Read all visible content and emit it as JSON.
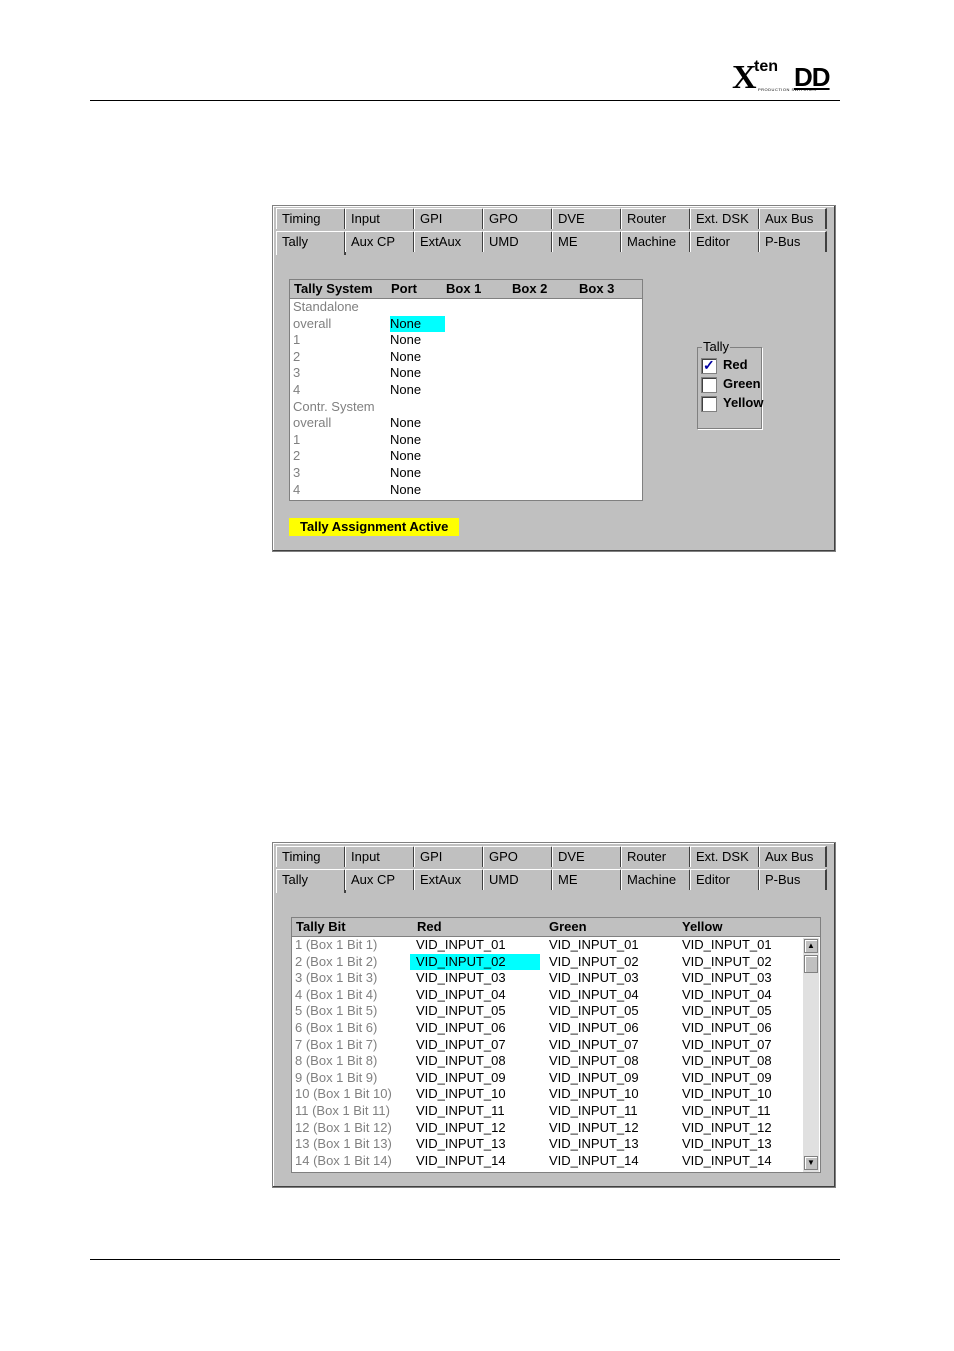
{
  "header": {
    "logo_x": "X",
    "logo_ten": "ten",
    "logo_dd": "DD",
    "logo_tagline": "PRODUCTION SWITCHER"
  },
  "tabs_row1": [
    "Timing",
    "Input",
    "GPI",
    "GPO",
    "DVE",
    "Router",
    "Ext. DSK",
    "Aux Bus"
  ],
  "tabs_row2": [
    "Tally",
    "Aux CP",
    "ExtAux",
    "UMD",
    "ME",
    "Machine",
    "Editor",
    "P-Bus"
  ],
  "panel1": {
    "columns": [
      "Tally System",
      "Port",
      "Box 1",
      "Box 2",
      "Box 3"
    ],
    "rows": [
      {
        "label": "Standalone",
        "port": ""
      },
      {
        "label": "overall",
        "port": "None",
        "highlight": true
      },
      {
        "label": "1",
        "port": "None"
      },
      {
        "label": "2",
        "port": "None"
      },
      {
        "label": "3",
        "port": "None"
      },
      {
        "label": "4",
        "port": "None"
      },
      {
        "label": "Contr. System",
        "port": ""
      },
      {
        "label": "overall",
        "port": "None"
      },
      {
        "label": "1",
        "port": "None"
      },
      {
        "label": "2",
        "port": "None"
      },
      {
        "label": "3",
        "port": "None"
      },
      {
        "label": "4",
        "port": "None"
      }
    ],
    "tally_group": {
      "title": "Tally",
      "options": [
        {
          "label": "Red",
          "checked": true
        },
        {
          "label": "Green",
          "checked": false
        },
        {
          "label": "Yellow",
          "checked": false
        }
      ]
    },
    "status": "Tally Assignment Active",
    "check_mark": "✓"
  },
  "panel2": {
    "columns": [
      "Tally Bit",
      "Red",
      "Green",
      "Yellow"
    ],
    "rows": [
      {
        "bit": "1 (Box 1 Bit 1)",
        "red": "VID_INPUT_01",
        "green": "VID_INPUT_01",
        "yellow": "VID_INPUT_01"
      },
      {
        "bit": "2 (Box 1 Bit 2)",
        "red": "VID_INPUT_02",
        "green": "VID_INPUT_02",
        "yellow": "VID_INPUT_02",
        "highlight": true
      },
      {
        "bit": "3 (Box 1 Bit 3)",
        "red": "VID_INPUT_03",
        "green": "VID_INPUT_03",
        "yellow": "VID_INPUT_03"
      },
      {
        "bit": "4 (Box 1 Bit 4)",
        "red": "VID_INPUT_04",
        "green": "VID_INPUT_04",
        "yellow": "VID_INPUT_04"
      },
      {
        "bit": "5 (Box 1 Bit 5)",
        "red": "VID_INPUT_05",
        "green": "VID_INPUT_05",
        "yellow": "VID_INPUT_05"
      },
      {
        "bit": "6 (Box 1 Bit 6)",
        "red": "VID_INPUT_06",
        "green": "VID_INPUT_06",
        "yellow": "VID_INPUT_06"
      },
      {
        "bit": "7 (Box 1 Bit 7)",
        "red": "VID_INPUT_07",
        "green": "VID_INPUT_07",
        "yellow": "VID_INPUT_07"
      },
      {
        "bit": "8 (Box 1 Bit 8)",
        "red": "VID_INPUT_08",
        "green": "VID_INPUT_08",
        "yellow": "VID_INPUT_08"
      },
      {
        "bit": "9 (Box 1 Bit 9)",
        "red": "VID_INPUT_09",
        "green": "VID_INPUT_09",
        "yellow": "VID_INPUT_09"
      },
      {
        "bit": "10 (Box 1 Bit 10)",
        "red": "VID_INPUT_10",
        "green": "VID_INPUT_10",
        "yellow": "VID_INPUT_10"
      },
      {
        "bit": "11 (Box 1 Bit 11)",
        "red": "VID_INPUT_11",
        "green": "VID_INPUT_11",
        "yellow": "VID_INPUT_11"
      },
      {
        "bit": "12 (Box 1 Bit 12)",
        "red": "VID_INPUT_12",
        "green": "VID_INPUT_12",
        "yellow": "VID_INPUT_12"
      },
      {
        "bit": "13 (Box 1 Bit 13)",
        "red": "VID_INPUT_13",
        "green": "VID_INPUT_13",
        "yellow": "VID_INPUT_13"
      },
      {
        "bit": "14 (Box 1 Bit 14)",
        "red": "VID_INPUT_14",
        "green": "VID_INPUT_14",
        "yellow": "VID_INPUT_14"
      }
    ],
    "scroll_up": "▲",
    "scroll_down": "▼"
  },
  "colors": {
    "panel": "#c0c0c0",
    "highlight": "#00ffff",
    "status": "#ffff00"
  }
}
